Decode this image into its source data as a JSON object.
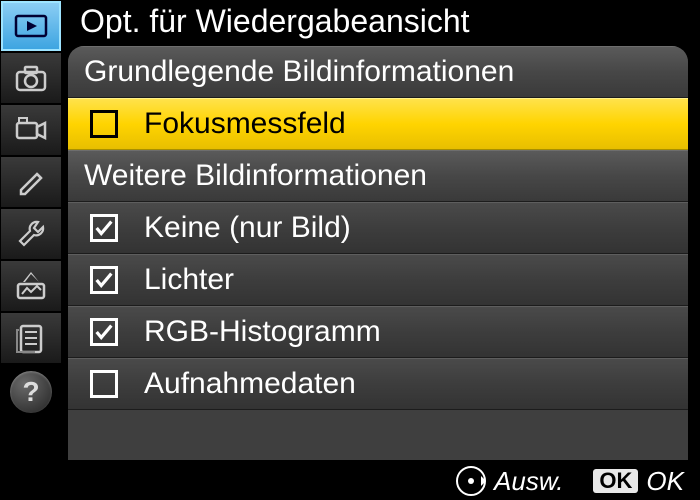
{
  "title": "Opt. für Wiedergabeansicht",
  "sections": [
    {
      "header": "Grundlegende Bildinformationen",
      "items": [
        {
          "label": "Fokusmessfeld",
          "checked": false,
          "highlight": true
        }
      ]
    },
    {
      "header": "Weitere Bildinformationen",
      "items": [
        {
          "label": "Keine (nur Bild)",
          "checked": true,
          "highlight": false
        },
        {
          "label": "Lichter",
          "checked": true,
          "highlight": false
        },
        {
          "label": "RGB-Histogramm",
          "checked": true,
          "highlight": false
        },
        {
          "label": "Aufnahmedaten",
          "checked": false,
          "highlight": false
        }
      ]
    }
  ],
  "footer": {
    "select_label": "Ausw.",
    "ok_badge": "OK",
    "ok_label": "OK"
  },
  "sidebar": [
    {
      "name": "playback",
      "active": true
    },
    {
      "name": "camera",
      "active": false
    },
    {
      "name": "video",
      "active": false
    },
    {
      "name": "pencil",
      "active": false
    },
    {
      "name": "wrench",
      "active": false
    },
    {
      "name": "retouch",
      "active": false
    },
    {
      "name": "mymenu",
      "active": false
    }
  ]
}
